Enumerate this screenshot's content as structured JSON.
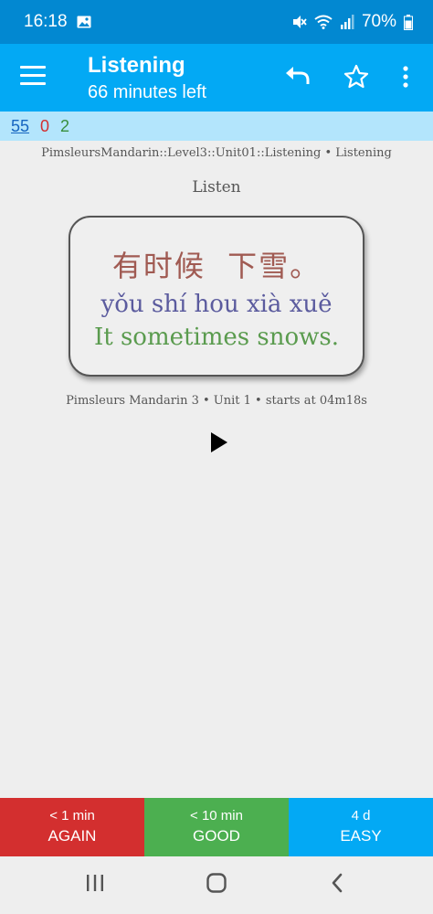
{
  "status_bar": {
    "time": "16:18",
    "battery": "70%"
  },
  "app_bar": {
    "title": "Listening",
    "subtitle": "66 minutes left",
    "icons": [
      "menu-icon",
      "undo-icon",
      "star-icon",
      "more-vert-icon"
    ]
  },
  "counts": {
    "new": "55",
    "learning": "0",
    "review": "2"
  },
  "card": {
    "deck_path": "PimsleursMandarin::Level3::Unit01::Listening • Listening",
    "label": "Listen",
    "hanzi": "有时候  下雪。",
    "pinyin": "yǒu shí hou xià xuě",
    "english": "It sometimes snows.",
    "source": "Pimsleurs Mandarin 3 • Unit 1 • starts at 04m18s"
  },
  "answers": [
    {
      "interval": "< 1 min",
      "label": "AGAIN",
      "color": "#d32f2f"
    },
    {
      "interval": "< 10 min",
      "label": "GOOD",
      "color": "#4caf50"
    },
    {
      "interval": "4 d",
      "label": "EASY",
      "color": "#03a9f4"
    }
  ],
  "colors": {
    "status_bar": "#0288d1",
    "app_bar": "#03a9f4",
    "counts_bar": "#b3e5fc"
  }
}
